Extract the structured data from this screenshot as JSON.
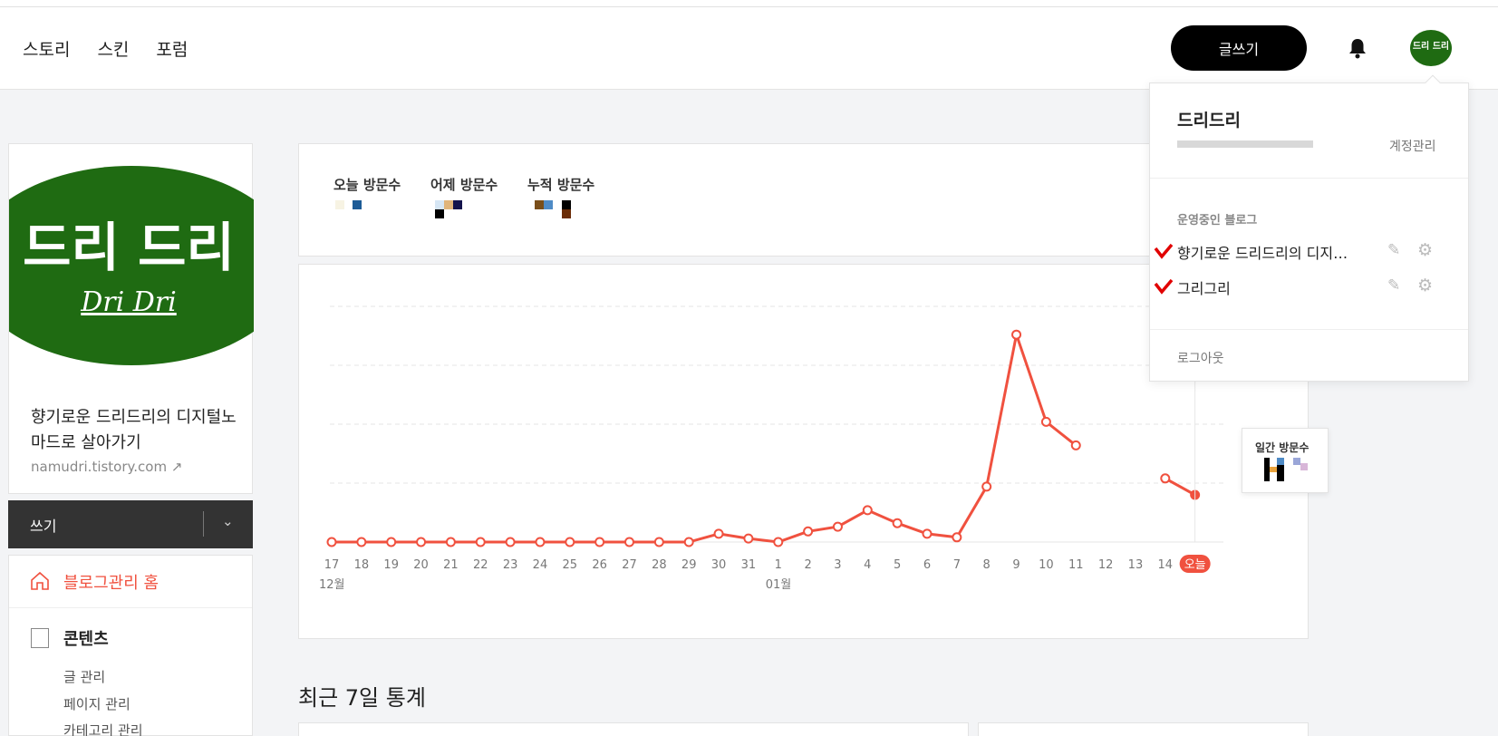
{
  "header": {
    "nav": [
      "스토리",
      "스킨",
      "포럼"
    ],
    "write_label": "글쓰기",
    "avatar_text": "드리 드리"
  },
  "sidebar": {
    "logo_text_top": "드리 드리",
    "logo_text_bottom": "Dri Dri",
    "blog_title": "향기로운 드리드리의 디지털노마드로 살아가기",
    "blog_url": "namudri.tistory.com",
    "write_label": "쓰기",
    "home_label": "블로그관리 홈",
    "content_label": "콘텐츠",
    "submenu": [
      "글 관리",
      "페이지 관리",
      "카테고리 관리"
    ]
  },
  "stats": {
    "today_label": "오늘 방문수",
    "yesterday_label": "어제 방문수",
    "total_label": "누적 방문수"
  },
  "chart_data": {
    "type": "line",
    "x": [
      "17",
      "18",
      "19",
      "20",
      "21",
      "22",
      "23",
      "24",
      "25",
      "26",
      "27",
      "28",
      "29",
      "30",
      "31",
      "1",
      "2",
      "3",
      "4",
      "5",
      "6",
      "7",
      "8",
      "9",
      "10",
      "11",
      "12",
      "13",
      "14",
      "오늘"
    ],
    "month_labels": [
      "12월",
      "01월"
    ],
    "series": [
      {
        "values": [
          0,
          0,
          0,
          0,
          0,
          0,
          0,
          0,
          0,
          0,
          0,
          0,
          0,
          0.35,
          0.15,
          0,
          0.45,
          0.65,
          1.35,
          0.8,
          0.35,
          0.2,
          2.35,
          8.8,
          5.1,
          4.1,
          null,
          null,
          2.7,
          2.0
        ]
      }
    ],
    "highlight_label": "오늘",
    "color": "#f0513f"
  },
  "tooltip": {
    "label": "일간 방문수"
  },
  "recent_title": "최근 7일 통계",
  "dropdown": {
    "name": "드리드리",
    "account_label": "계정관리",
    "section_label": "운영중인 블로그",
    "blogs": [
      "향기로운 드리드리의 디지…",
      "그리그리"
    ],
    "logout_label": "로그아웃"
  }
}
